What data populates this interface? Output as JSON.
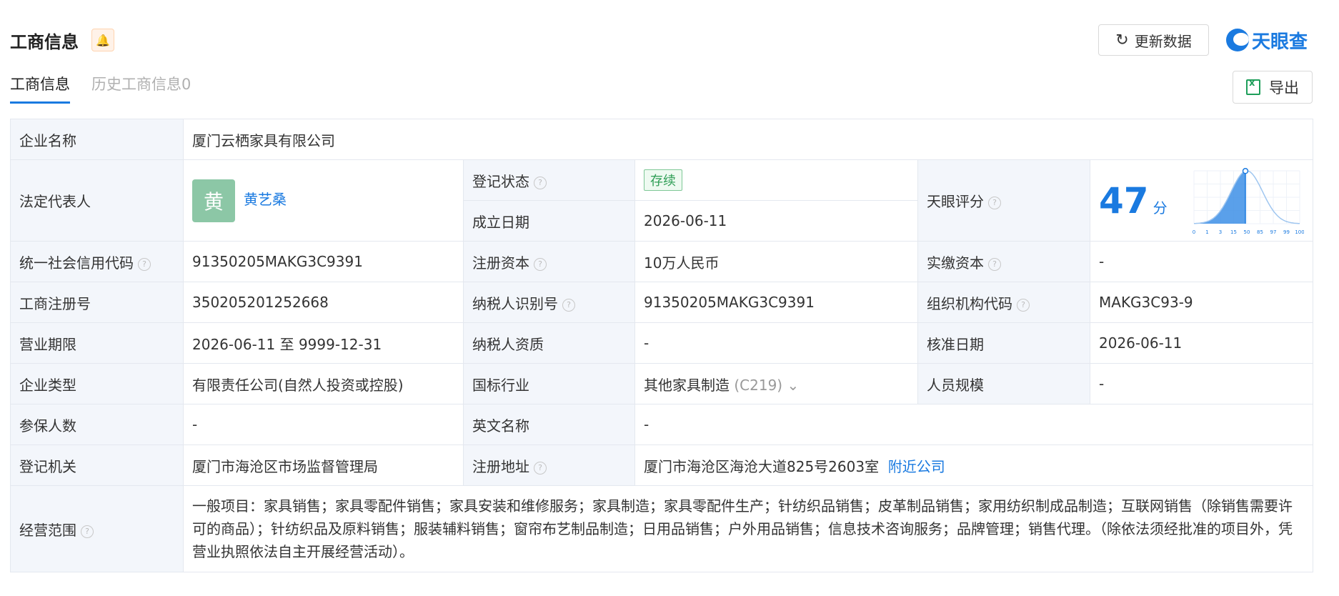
{
  "header": {
    "title": "工商信息",
    "refresh_label": "更新数据",
    "logo_text": "天眼查"
  },
  "tabs": [
    {
      "label": "工商信息"
    },
    {
      "label": "历史工商信息0"
    }
  ],
  "export_label": "导出",
  "fields": {
    "company_name_label": "企业名称",
    "company_name": "厦门云栖家具有限公司",
    "legal_rep_label": "法定代表人",
    "legal_rep_avatar": "黄",
    "legal_rep_name": "黄艺桑",
    "reg_status_label": "登记状态",
    "reg_status": "存续",
    "found_date_label": "成立日期",
    "found_date": "2026-06-11",
    "score_label": "天眼评分",
    "score": "47",
    "score_unit": "分",
    "credit_code_label": "统一社会信用代码",
    "credit_code": "91350205MAKG3C9391",
    "reg_capital_label": "注册资本",
    "reg_capital": "10万人民币",
    "paid_capital_label": "实缴资本",
    "paid_capital": "-",
    "reg_no_label": "工商注册号",
    "reg_no": "350205201252668",
    "taxpayer_id_label": "纳税人识别号",
    "taxpayer_id": "91350205MAKG3C9391",
    "org_code_label": "组织机构代码",
    "org_code": "MAKG3C93-9",
    "biz_term_label": "营业期限",
    "biz_term": "2026-06-11 至 9999-12-31",
    "taxpayer_qual_label": "纳税人资质",
    "taxpayer_qual": "-",
    "approve_date_label": "核准日期",
    "approve_date": "2026-06-11",
    "company_type_label": "企业类型",
    "company_type": "有限责任公司(自然人投资或控股)",
    "industry_label": "国标行业",
    "industry": "其他家具制造",
    "industry_code": "(C219)",
    "staff_size_label": "人员规模",
    "staff_size": "-",
    "insured_label": "参保人数",
    "insured": "-",
    "english_name_label": "英文名称",
    "english_name": "-",
    "reg_authority_label": "登记机关",
    "reg_authority": "厦门市海沧区市场监督管理局",
    "reg_address_label": "注册地址",
    "reg_address": "厦门市海沧区海沧大道825号2603室",
    "nearby_link": "附近公司",
    "scope_label": "经营范围",
    "scope": "一般项目：家具销售；家具零配件销售；家具安装和维修服务；家具制造；家具零配件生产；针纺织品销售；皮革制品销售；家用纺织制成品制造；互联网销售（除销售需要许可的商品）；针纺织品及原料销售；服装辅料销售；窗帘布艺制品制造；日用品销售；户外用品销售；信息技术咨询服务；品牌管理；销售代理。（除依法须经批准的项目外，凭营业执照依法自主开展经营活动）。"
  },
  "score_chart": {
    "ticks": [
      "0",
      "1",
      "3",
      "15",
      "50",
      "85",
      "97",
      "99",
      "100"
    ]
  },
  "colors": {
    "accent": "#1a7ae0",
    "label_bg": "#f3f6fb",
    "status_green": "#2e9e55"
  }
}
